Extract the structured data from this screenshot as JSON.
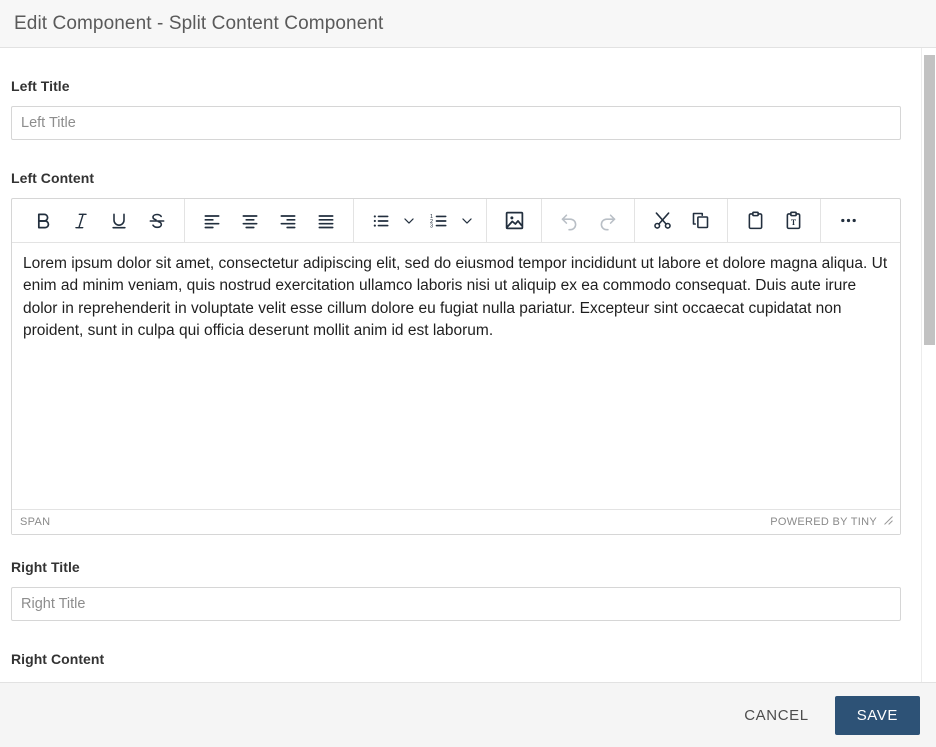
{
  "dialog": {
    "title": "Edit Component - Split Content Component"
  },
  "fields": {
    "left_title": {
      "label": "Left Title",
      "placeholder": "Left Title",
      "value": ""
    },
    "left_content": {
      "label": "Left Content",
      "body": "Lorem ipsum dolor sit amet, consectetur adipiscing elit, sed do eiusmod tempor incididunt ut labore et dolore magna aliqua. Ut enim ad minim veniam, quis nostrud exercitation ullamco laboris nisi ut aliquip ex ea commodo consequat. Duis aute irure dolor in reprehenderit in voluptate velit esse cillum dolore eu fugiat nulla pariatur. Excepteur sint occaecat cupidatat non proident, sunt in culpa qui officia deserunt mollit anim id est laborum."
    },
    "right_title": {
      "label": "Right Title",
      "placeholder": "Right Title",
      "value": ""
    },
    "right_content": {
      "label": "Right Content"
    }
  },
  "editor": {
    "toolbar": [
      {
        "name": "bold",
        "label": "Bold",
        "icon": "bold-icon",
        "disabled": false
      },
      {
        "name": "italic",
        "label": "Italic",
        "icon": "italic-icon",
        "disabled": false
      },
      {
        "name": "underline",
        "label": "Underline",
        "icon": "underline-icon",
        "disabled": false
      },
      {
        "name": "strikethrough",
        "label": "Strikethrough",
        "icon": "strikethrough-icon",
        "disabled": false
      },
      {
        "name": "align-left",
        "label": "Align left",
        "icon": "align-left-icon",
        "disabled": false
      },
      {
        "name": "align-center",
        "label": "Align center",
        "icon": "align-center-icon",
        "disabled": false
      },
      {
        "name": "align-right",
        "label": "Align right",
        "icon": "align-right-icon",
        "disabled": false
      },
      {
        "name": "align-justify",
        "label": "Justify",
        "icon": "align-justify-icon",
        "disabled": false
      },
      {
        "name": "bullet-list",
        "label": "Bullet list",
        "icon": "bullet-list-icon",
        "disabled": false
      },
      {
        "name": "bullet-list-options",
        "label": "Bullet list options",
        "icon": "chevron-down-icon",
        "disabled": false
      },
      {
        "name": "numbered-list",
        "label": "Numbered list",
        "icon": "numbered-list-icon",
        "disabled": false
      },
      {
        "name": "numbered-list-options",
        "label": "Numbered list options",
        "icon": "chevron-down-icon",
        "disabled": false
      },
      {
        "name": "insert-image",
        "label": "Insert image",
        "icon": "image-icon",
        "disabled": false
      },
      {
        "name": "undo",
        "label": "Undo",
        "icon": "undo-icon",
        "disabled": true
      },
      {
        "name": "redo",
        "label": "Redo",
        "icon": "redo-icon",
        "disabled": true
      },
      {
        "name": "cut",
        "label": "Cut",
        "icon": "scissors-icon",
        "disabled": false
      },
      {
        "name": "copy",
        "label": "Copy",
        "icon": "copy-icon",
        "disabled": false
      },
      {
        "name": "paste",
        "label": "Paste",
        "icon": "clipboard-icon",
        "disabled": false
      },
      {
        "name": "paste-as-text",
        "label": "Paste as text",
        "icon": "clipboard-text-icon",
        "disabled": false
      },
      {
        "name": "more",
        "label": "More",
        "icon": "ellipsis-icon",
        "disabled": false
      }
    ],
    "statusbar": {
      "element_path": "SPAN",
      "branding": "POWERED BY TINY",
      "resize_handle": "resize-handle-icon"
    }
  },
  "footer": {
    "cancel_label": "CANCEL",
    "save_label": "SAVE"
  },
  "colors": {
    "accent": "#2d5276",
    "header_bg": "#f7f7f7",
    "footer_bg": "#f5f5f5",
    "icon": "#222f3e",
    "icon_disabled": "#b9bfc6",
    "border": "#d6d6d6"
  }
}
